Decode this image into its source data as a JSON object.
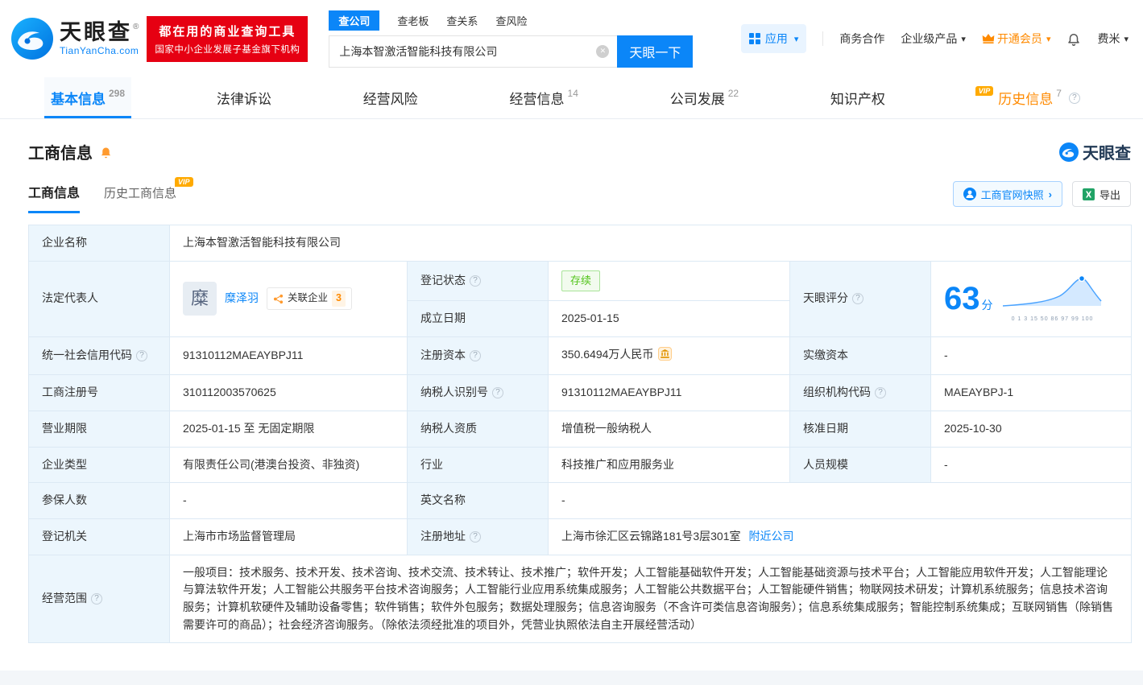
{
  "header": {
    "brand": "天眼查",
    "brand_reg": "®",
    "domain": "TianYanCha.com",
    "slogan1": "都在用的商业查询工具",
    "slogan2": "国家中小企业发展子基金旗下机构",
    "search_tabs": [
      "查公司",
      "查老板",
      "查关系",
      "查风险"
    ],
    "search_value": "上海本智激活智能科技有限公司",
    "search_button": "天眼一下",
    "nav": {
      "apps": "应用",
      "business": "商务合作",
      "enterprise": "企业级产品",
      "vip": "开通会员",
      "user": "费米"
    }
  },
  "tabs": [
    {
      "label": "基本信息",
      "count": "298"
    },
    {
      "label": "法律诉讼",
      "count": ""
    },
    {
      "label": "经营风险",
      "count": ""
    },
    {
      "label": "经营信息",
      "count": "14"
    },
    {
      "label": "公司发展",
      "count": "22"
    },
    {
      "label": "知识产权",
      "count": ""
    },
    {
      "label": "历史信息",
      "count": "7"
    }
  ],
  "misc": {
    "vip": "VIP"
  },
  "section": {
    "title": "工商信息",
    "watermark": "天眼查",
    "subtab_active": "工商信息",
    "subtab_history": "历史工商信息",
    "snapshot": "工商官网快照",
    "export": "导出"
  },
  "fields": {
    "company_name": {
      "label": "企业名称",
      "value": "上海本智激活智能科技有限公司"
    },
    "legal_rep": {
      "label": "法定代表人",
      "value": "糜泽羽",
      "avatar": "糜",
      "related_label": "关联企业",
      "related_count": "3"
    },
    "reg_status": {
      "label": "登记状态",
      "value": "存续"
    },
    "establish_date": {
      "label": "成立日期",
      "value": "2025-01-15"
    },
    "score": {
      "label": "天眼评分",
      "value": "63",
      "unit": "分",
      "axis": "0 1 3 15 50 86 97 99 100"
    },
    "credit_code": {
      "label": "统一社会信用代码",
      "value": "91310112MAEAYBPJ11"
    },
    "reg_capital": {
      "label": "注册资本",
      "value": "350.6494万人民币"
    },
    "paid_capital": {
      "label": "实缴资本",
      "value": "-"
    },
    "reg_number": {
      "label": "工商注册号",
      "value": "310112003570625"
    },
    "taxpayer_id": {
      "label": "纳税人识别号",
      "value": "91310112MAEAYBPJ11"
    },
    "org_code": {
      "label": "组织机构代码",
      "value": "MAEAYBPJ-1"
    },
    "business_term": {
      "label": "营业期限",
      "value": "2025-01-15 至 无固定期限"
    },
    "taxpayer_quality": {
      "label": "纳税人资质",
      "value": "增值税一般纳税人"
    },
    "approval_date": {
      "label": "核准日期",
      "value": "2025-10-30"
    },
    "company_type": {
      "label": "企业类型",
      "value": "有限责任公司(港澳台投资、非独资)"
    },
    "industry": {
      "label": "行业",
      "value": "科技推广和应用服务业"
    },
    "staff_size": {
      "label": "人员规模",
      "value": "-"
    },
    "insured_count": {
      "label": "参保人数",
      "value": "-"
    },
    "english_name": {
      "label": "英文名称",
      "value": "-"
    },
    "reg_authority": {
      "label": "登记机关",
      "value": "上海市市场监督管理局"
    },
    "address": {
      "label": "注册地址",
      "value": "上海市徐汇区云锦路181号3层301室",
      "nearby": "附近公司"
    },
    "business_scope": {
      "label": "经营范围",
      "value": "一般项目：技术服务、技术开发、技术咨询、技术交流、技术转让、技术推广；软件开发；人工智能基础软件开发；人工智能基础资源与技术平台；人工智能应用软件开发；人工智能理论与算法软件开发；人工智能公共服务平台技术咨询服务；人工智能行业应用系统集成服务；人工智能公共数据平台；人工智能硬件销售；物联网技术研发；计算机系统服务；信息技术咨询服务；计算机软硬件及辅助设备零售；软件销售；软件外包服务；数据处理服务；信息咨询服务（不含许可类信息咨询服务）；信息系统集成服务；智能控制系统集成；互联网销售（除销售需要许可的商品）；社会经济咨询服务。（除依法须经批准的项目外，凭营业执照依法自主开展经营活动）"
    }
  },
  "colors": {
    "brand_blue": "#0b86f8",
    "vip_orange": "#ff8a00",
    "status_green": "#52c41a",
    "banner_red": "#e60012"
  }
}
